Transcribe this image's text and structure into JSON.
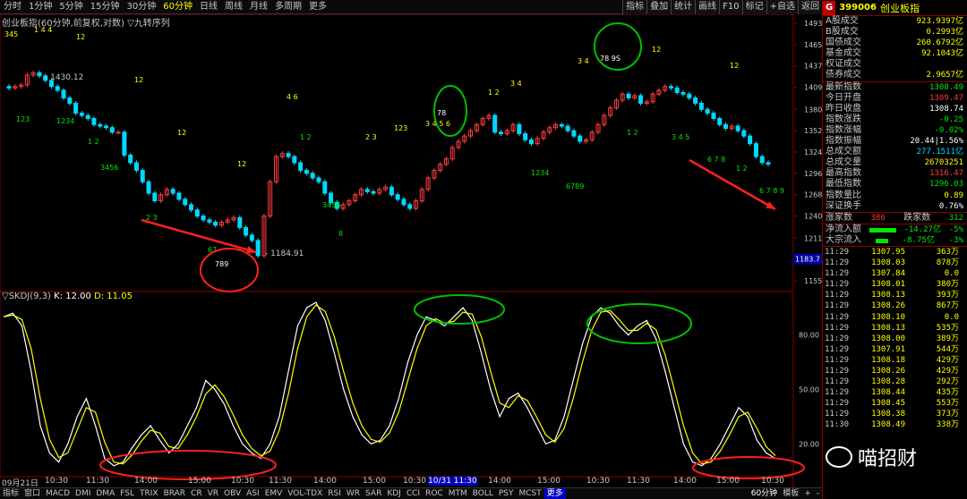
{
  "toolbar": {
    "tabs": [
      "分时",
      "1分钟",
      "5分钟",
      "15分钟",
      "30分钟",
      "60分钟",
      "日线",
      "周线",
      "月线",
      "多周期",
      "更多"
    ],
    "active_tab": "60分钟",
    "right_buttons": [
      "指标",
      "叠加",
      "统计",
      "画线",
      "F10",
      "标记",
      "+自选",
      "返回"
    ]
  },
  "chart": {
    "title": "创业板指(60分钟,前复权,对数) ▽九转序列",
    "high_label": "1430.12",
    "low_label": "1184.91",
    "last_price_tag": "1183.7",
    "price_axis": [
      "1493",
      "1465",
      "1437",
      "1409",
      "1380",
      "1352",
      "1324",
      "1296",
      "1268",
      "1240",
      "1211",
      "1183",
      "1155"
    ],
    "kdj_title": "▽SKDJ(9,3)",
    "kdj_k": "K: 12.00",
    "kdj_d": "D: 11.05",
    "kdj_axis": [
      "80.00",
      "50.00",
      "20.00"
    ],
    "time_labels": [
      "09月21日",
      "10:30",
      "11:30",
      "14:00",
      "15:00",
      "10:30",
      "11:30",
      "14:00",
      "15:00",
      "10:30",
      "10/31 11:30",
      "14:00",
      "15:00",
      "10:30",
      "11:30",
      "14:00",
      "15:00",
      "10:30"
    ],
    "zoom_label": "60分钟"
  },
  "panel": {
    "g_label": "G",
    "code": "399006",
    "name": "创业板指",
    "stats1": [
      {
        "label": "A股成交",
        "value": "923.9397亿",
        "color": "yel"
      },
      {
        "label": "B股成交",
        "value": "0.2993亿",
        "color": "yel"
      },
      {
        "label": "国债成交",
        "value": "260.6792亿",
        "color": "yel"
      },
      {
        "label": "基金成交",
        "value": "92.1043亿",
        "color": "yel"
      },
      {
        "label": "权证成交",
        "value": "",
        "color": "yel"
      },
      {
        "label": "债券成交",
        "value": "2.9657亿",
        "color": "yel"
      }
    ],
    "stats2": [
      {
        "label": "最新指数",
        "value": "1308.49",
        "color": "grn"
      },
      {
        "label": "今日开盘",
        "value": "1309.47",
        "color": "red"
      },
      {
        "label": "昨日收盘",
        "value": "1308.74",
        "color": "wht"
      },
      {
        "label": "指数涨跌",
        "value": "-0.25",
        "color": "grn"
      },
      {
        "label": "指数涨幅",
        "value": "-0.02%",
        "color": "grn"
      },
      {
        "label": "指数振幅",
        "value": "20.44|1.56%",
        "color": "wht"
      },
      {
        "label": "总成交额",
        "value": "277.1511亿",
        "color": "cyan"
      },
      {
        "label": "总成交量",
        "value": "26703251",
        "color": "yel"
      },
      {
        "label": "最高指数",
        "value": "1316.47",
        "color": "red"
      },
      {
        "label": "最低指数",
        "value": "1296.03",
        "color": "grn"
      },
      {
        "label": "指数量比",
        "value": "0.89",
        "color": "yel"
      },
      {
        "label": "深证换手",
        "value": "0.76%",
        "color": "wht"
      }
    ],
    "updown": {
      "up_label": "涨家数",
      "up": "386",
      "down_label": "跌家数",
      "down": "312"
    },
    "flows": [
      {
        "label": "净流入额",
        "value": "-14.27亿",
        "pct": "-5%"
      },
      {
        "label": "大宗流入",
        "value": "-8.75亿",
        "pct": "-3%"
      }
    ],
    "ticks": [
      [
        "11:29",
        "1307.95",
        "363万"
      ],
      [
        "11:29",
        "1308.03",
        "878万"
      ],
      [
        "11:29",
        "1307.84",
        "0.0"
      ],
      [
        "11:29",
        "1308.01",
        "380万"
      ],
      [
        "11:29",
        "1308.13",
        "393万"
      ],
      [
        "11:29",
        "1308.26",
        "867万"
      ],
      [
        "11:29",
        "1308.10",
        "0.0"
      ],
      [
        "11:29",
        "1308.13",
        "535万"
      ],
      [
        "11:29",
        "1308.00",
        "389万"
      ],
      [
        "11:29",
        "1307.91",
        "544万"
      ],
      [
        "11:29",
        "1308.18",
        "429万"
      ],
      [
        "11:29",
        "1308.26",
        "429万"
      ],
      [
        "11:29",
        "1308.28",
        "292万"
      ],
      [
        "11:29",
        "1308.44",
        "435万"
      ],
      [
        "11:29",
        "1308.45",
        "553万"
      ],
      [
        "11:29",
        "1308.38",
        "373万"
      ],
      [
        "11:30",
        "1308.49",
        "338万"
      ]
    ]
  },
  "bottombar": {
    "items": [
      "指标",
      "窗口",
      "MACD",
      "DMI",
      "DMA",
      "FSL",
      "TRIX",
      "BRAR",
      "CR",
      "VR",
      "OBV",
      "ASI",
      "EMV",
      "VOL-TDX",
      "RSI",
      "WR",
      "SAR",
      "KDJ",
      "CCI",
      "ROC",
      "MTM",
      "BOLL",
      "PSY",
      "MCST",
      "更多"
    ],
    "selected": "更多",
    "right_items": [
      "模板",
      "+",
      "-"
    ]
  },
  "watermark": {
    "text": "喵招财"
  }
}
